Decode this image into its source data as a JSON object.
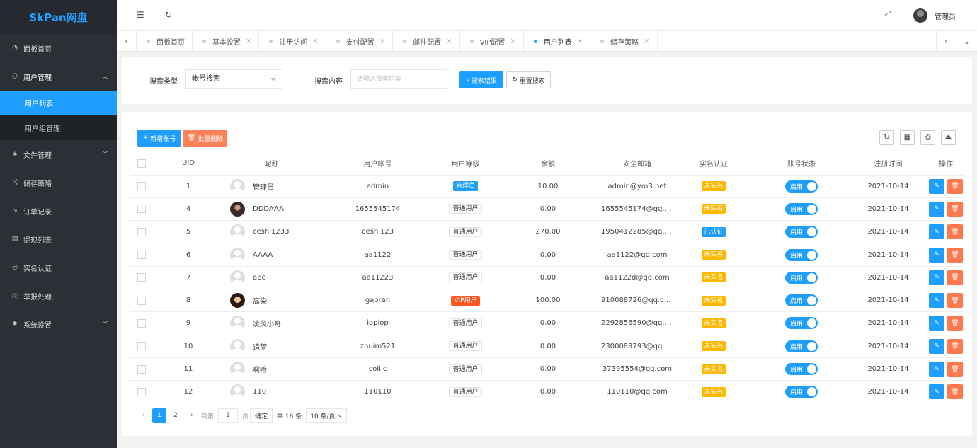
{
  "app": {
    "logo": "SkPan网盘"
  },
  "sidebar": {
    "items": [
      {
        "icon": "dashboard-icon",
        "glyph": "◔",
        "label": "面板首页"
      },
      {
        "icon": "cube-icon",
        "glyph": "⬡",
        "label": "用户管理",
        "open": true,
        "children": [
          {
            "label": "用户列表",
            "active": true
          },
          {
            "label": "用户组管理"
          }
        ]
      },
      {
        "icon": "layers-icon",
        "glyph": "◈",
        "label": "文件管理",
        "expandable": true
      },
      {
        "icon": "shuffle-icon",
        "glyph": "⤮",
        "label": "储存策略"
      },
      {
        "icon": "pulse-icon",
        "glyph": "∿",
        "label": "订单记录"
      },
      {
        "icon": "list-icon",
        "glyph": "▤",
        "label": "提现列表"
      },
      {
        "icon": "shield-check-icon",
        "glyph": "◎",
        "label": "实名认证"
      },
      {
        "icon": "info-circle-icon",
        "glyph": "ⓘ",
        "label": "举报处理"
      },
      {
        "icon": "gear-icon",
        "glyph": "✹",
        "label": "系统设置",
        "expandable": true
      }
    ]
  },
  "header": {
    "user_name": "管理员"
  },
  "tabs": [
    {
      "label": "面板首页",
      "closable": false
    },
    {
      "label": "基本设置",
      "closable": true
    },
    {
      "label": "注册访问",
      "closable": true
    },
    {
      "label": "支付配置",
      "closable": true
    },
    {
      "label": "邮件配置",
      "closable": true
    },
    {
      "label": "VIP配置",
      "closable": true
    },
    {
      "label": "用户列表",
      "closable": true,
      "active": true
    },
    {
      "label": "储存策略",
      "closable": true
    }
  ],
  "search": {
    "type_label": "搜索类型",
    "type_value": "帐号搜索",
    "content_label": "搜索内容",
    "content_placeholder": "请输入搜索内容",
    "search_button": "搜索结果",
    "reset_button": "重置搜索"
  },
  "toolbar": {
    "add_button": "新增账号",
    "batch_delete_button": "批量删除"
  },
  "table": {
    "headers": [
      "UID",
      "昵称",
      "用户帐号",
      "用户等级",
      "余额",
      "安全邮箱",
      "实名认证",
      "账号状态",
      "注册时间",
      "操作"
    ],
    "rows": [
      {
        "uid": "1",
        "nickname": "管理员",
        "avatar": "default",
        "account": "admin",
        "level": "管理员",
        "level_type": "admin",
        "balance": "10.00",
        "email": "admin@ym3.net",
        "verify": "未实名",
        "verify_type": "no",
        "status": "启用",
        "reg_time": "2021-10-14"
      },
      {
        "uid": "4",
        "nickname": "DDDAAA",
        "avatar": "photo1",
        "account": "1655545174",
        "level": "普通用户",
        "level_type": "normal",
        "balance": "0.00",
        "email": "1655545174@qq.c...",
        "verify": "未实名",
        "verify_type": "no",
        "status": "启用",
        "reg_time": "2021-10-14"
      },
      {
        "uid": "5",
        "nickname": "ceshi1233",
        "avatar": "default",
        "account": "ceshi123",
        "level": "普通用户",
        "level_type": "normal",
        "balance": "270.00",
        "email": "1950412285@qq.c...",
        "verify": "已认证",
        "verify_type": "yes",
        "status": "启用",
        "reg_time": "2021-10-14"
      },
      {
        "uid": "6",
        "nickname": "AAAA",
        "avatar": "default",
        "account": "aa1122",
        "level": "普通用户",
        "level_type": "normal",
        "balance": "0.00",
        "email": "aa1122@qq.com",
        "verify": "未实名",
        "verify_type": "no",
        "status": "启用",
        "reg_time": "2021-10-14"
      },
      {
        "uid": "7",
        "nickname": "abc",
        "avatar": "default",
        "account": "aa11223",
        "level": "普通用户",
        "level_type": "normal",
        "balance": "0.00",
        "email": "aa1122d@qq.com",
        "verify": "未实名",
        "verify_type": "no",
        "status": "启用",
        "reg_time": "2021-10-14"
      },
      {
        "uid": "8",
        "nickname": "高染",
        "avatar": "photo2",
        "account": "gaoran",
        "level": "VIP用户",
        "level_type": "vip",
        "balance": "100.00",
        "email": "910088726@qq.com",
        "verify": "未实名",
        "verify_type": "no",
        "status": "启用",
        "reg_time": "2021-10-14"
      },
      {
        "uid": "9",
        "nickname": "凌风小哥",
        "avatar": "default",
        "account": "iopiop",
        "level": "普通用户",
        "level_type": "normal",
        "balance": "0.00",
        "email": "2292856590@qq.c...",
        "verify": "未实名",
        "verify_type": "no",
        "status": "启用",
        "reg_time": "2021-10-14"
      },
      {
        "uid": "10",
        "nickname": "追梦",
        "avatar": "default",
        "account": "zhuim521",
        "level": "普通用户",
        "level_type": "normal",
        "balance": "0.00",
        "email": "2300089793@qq.c...",
        "verify": "未实名",
        "verify_type": "no",
        "status": "启用",
        "reg_time": "2021-10-14"
      },
      {
        "uid": "11",
        "nickname": "啊哈",
        "avatar": "default",
        "account": "coiilc",
        "level": "普通用户",
        "level_type": "normal",
        "balance": "0.00",
        "email": "37395554@qq.com",
        "verify": "未实名",
        "verify_type": "no",
        "status": "启用",
        "reg_time": "2021-10-14"
      },
      {
        "uid": "12",
        "nickname": "110",
        "avatar": "default",
        "account": "110110",
        "level": "普通用户",
        "level_type": "normal",
        "balance": "0.00",
        "email": "110110@qq.com",
        "verify": "未实名",
        "verify_type": "no",
        "status": "启用",
        "reg_time": "2021-10-14"
      }
    ]
  },
  "pagination": {
    "pages": [
      "1",
      "2"
    ],
    "current": "1",
    "goto_label": "到第",
    "goto_value": "1",
    "page_unit": "页",
    "confirm": "确定",
    "total": "共 16 条",
    "page_size": "10 条/页"
  },
  "colors": {
    "primary": "#1e9fff",
    "danger": "#ff5722",
    "warning": "#ffb800",
    "sidebar": "#2b2f36"
  }
}
